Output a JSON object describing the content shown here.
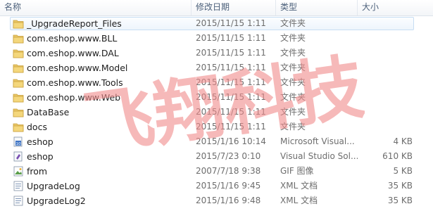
{
  "columns": {
    "name": "名称",
    "date": "修改日期",
    "type": "类型",
    "size": "大小"
  },
  "files": [
    {
      "name": "_UpgradeReport_Files",
      "date": "2015/11/15 1:11",
      "type": "文件夹",
      "size": "",
      "icon": "folder-icon",
      "selected": true
    },
    {
      "name": "com.eshop.www.BLL",
      "date": "2015/11/15 1:11",
      "type": "文件夹",
      "size": "",
      "icon": "folder-icon"
    },
    {
      "name": "com.eshop.www.DAL",
      "date": "2015/11/15 1:11",
      "type": "文件夹",
      "size": "",
      "icon": "folder-icon"
    },
    {
      "name": "com.eshop.www.Model",
      "date": "2015/11/15 1:11",
      "type": "文件夹",
      "size": "",
      "icon": "folder-icon"
    },
    {
      "name": "com.eshop.www.Tools",
      "date": "2015/11/15 1:11",
      "type": "文件夹",
      "size": "",
      "icon": "folder-icon"
    },
    {
      "name": "com.eshop.www.Web",
      "date": "2015/11/15 1:11",
      "type": "文件夹",
      "size": "",
      "icon": "folder-icon"
    },
    {
      "name": "DataBase",
      "date": "2015/11/15 1:11",
      "type": "文件夹",
      "size": "",
      "icon": "folder-icon"
    },
    {
      "name": "docs",
      "date": "2015/11/15 1:11",
      "type": "文件夹",
      "size": "",
      "icon": "folder-icon"
    },
    {
      "name": "eshop",
      "date": "2015/1/16 10:14",
      "type": "Microsoft Visual...",
      "size": "4 KB",
      "icon": "vs-project-icon"
    },
    {
      "name": "eshop",
      "date": "2015/7/23 0:10",
      "type": "Visual Studio Sol...",
      "size": "610 KB",
      "icon": "vs-solution-icon"
    },
    {
      "name": "from",
      "date": "2007/7/18 9:38",
      "type": "GIF 图像",
      "size": "5 KB",
      "icon": "gif-image-icon"
    },
    {
      "name": "UpgradeLog",
      "date": "2015/1/16 9:45",
      "type": "XML 文档",
      "size": "35 KB",
      "icon": "xml-document-icon"
    },
    {
      "name": "UpgradeLog2",
      "date": "2015/1/16 9:48",
      "type": "XML 文档",
      "size": "35 KB",
      "icon": "xml-document-icon"
    }
  ],
  "watermark": "飞翔科技",
  "colors": {
    "folder": "#e8c35a",
    "selection_border": "#c7ddf3",
    "watermark": "#f08a8a"
  }
}
